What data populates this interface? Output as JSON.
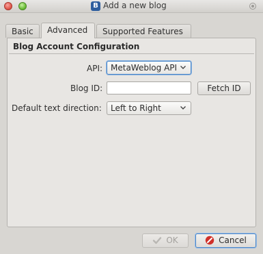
{
  "window": {
    "title": "Add a new blog",
    "app_icon_letter": "B"
  },
  "tabs": [
    {
      "label": "Basic",
      "active": false
    },
    {
      "label": "Advanced",
      "active": true
    },
    {
      "label": "Supported Features",
      "active": false
    }
  ],
  "section": {
    "title": "Blog Account Configuration"
  },
  "form": {
    "api_label": "API:",
    "api_value": "MetaWeblog API",
    "blog_id_label": "Blog ID:",
    "blog_id_value": "",
    "fetch_id_label": "Fetch ID",
    "text_direction_label": "Default text direction:",
    "text_direction_value": "Left to Right"
  },
  "footer": {
    "ok_label": "OK",
    "cancel_label": "Cancel"
  },
  "colors": {
    "focus_accent": "#4a86c8",
    "cancel_icon": "#d0302a",
    "ok_icon_disabled": "#b9b7b3"
  },
  "icons": {
    "close": "close-icon",
    "minimize": "minimize-icon",
    "app": "blogilo-icon",
    "window_menu": "window-menu-icon",
    "ok": "checkmark-icon",
    "cancel": "cancel-icon",
    "dropdown": "chevron-down-icon"
  }
}
